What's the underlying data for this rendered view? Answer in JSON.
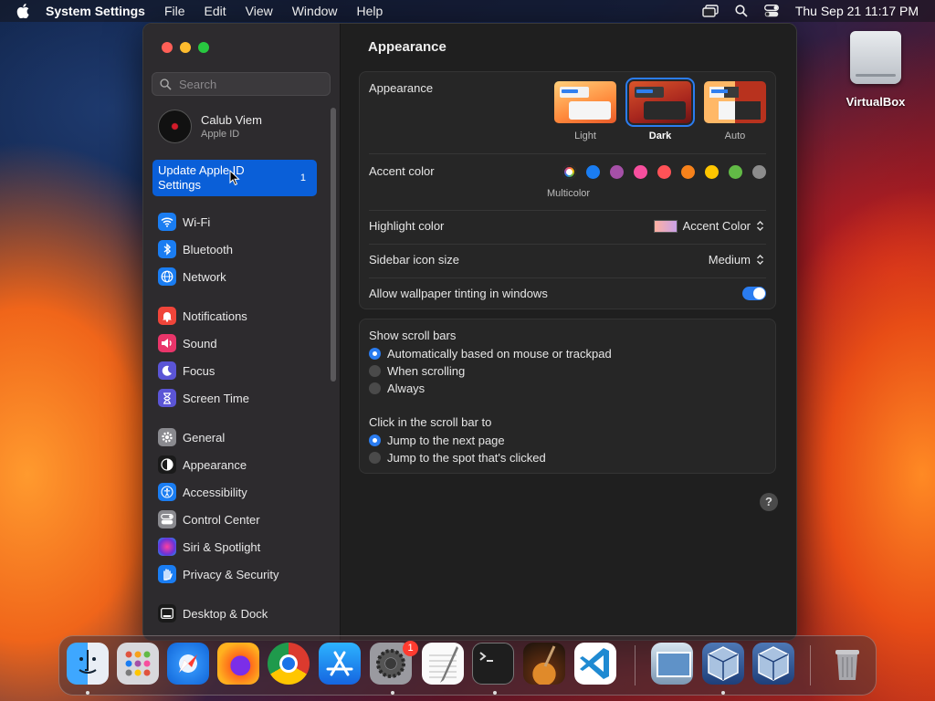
{
  "menubar": {
    "app": "System Settings",
    "items": [
      "File",
      "Edit",
      "View",
      "Window",
      "Help"
    ],
    "clock": "Thu Sep 21  11:17 PM"
  },
  "desktop": {
    "volume_label": "VirtualBox"
  },
  "sidebar": {
    "search_placeholder": "Search",
    "profile": {
      "name": "Calub Viem",
      "subtitle": "Apple ID"
    },
    "update": {
      "label": "Update Apple ID Settings",
      "badge": "1"
    },
    "items": [
      {
        "label": "Wi-Fi",
        "icon": "wifi-icon",
        "color": "#1a7df2"
      },
      {
        "label": "Bluetooth",
        "icon": "bluetooth-icon",
        "color": "#1a7df2"
      },
      {
        "label": "Network",
        "icon": "globe-icon",
        "color": "#1a7df2"
      },
      {
        "label": "Notifications",
        "icon": "bell-icon",
        "color": "#f0453a"
      },
      {
        "label": "Sound",
        "icon": "speaker-icon",
        "color": "#e9356a"
      },
      {
        "label": "Focus",
        "icon": "moon-icon",
        "color": "#5b55d6"
      },
      {
        "label": "Screen Time",
        "icon": "hourglass-icon",
        "color": "#5b55d6"
      },
      {
        "label": "General",
        "icon": "gear-icon",
        "color": "#8a8a8f"
      },
      {
        "label": "Appearance",
        "icon": "appearance-icon",
        "color": "#1a1a1a"
      },
      {
        "label": "Accessibility",
        "icon": "accessibility-icon",
        "color": "#1a7df2"
      },
      {
        "label": "Control Center",
        "icon": "control-center-icon",
        "color": "#8a8a8f"
      },
      {
        "label": "Siri & Spotlight",
        "icon": "siri-icon",
        "color": "#9b3ed4"
      },
      {
        "label": "Privacy & Security",
        "icon": "hand-icon",
        "color": "#1a7df2"
      },
      {
        "label": "Desktop & Dock",
        "icon": "dock-icon",
        "color": "#1a1a1a"
      }
    ]
  },
  "content": {
    "title": "Appearance",
    "appearance": {
      "label": "Appearance",
      "options": [
        "Light",
        "Dark",
        "Auto"
      ],
      "selected": "Dark"
    },
    "accent": {
      "label": "Accent color",
      "selected_caption": "Multicolor",
      "colors": [
        "multicolor",
        "#1a7df2",
        "#a550a7",
        "#f74f9e",
        "#ff5257",
        "#f7821b",
        "#ffc600",
        "#62ba46",
        "#8c8c8c"
      ]
    },
    "highlight": {
      "label": "Highlight color",
      "value": "Accent Color"
    },
    "icon_size": {
      "label": "Sidebar icon size",
      "value": "Medium"
    },
    "tinting": {
      "label": "Allow wallpaper tinting in windows",
      "on": true
    },
    "scroll_bars": {
      "label": "Show scroll bars",
      "options": [
        "Automatically based on mouse or trackpad",
        "When scrolling",
        "Always"
      ],
      "selected": 0
    },
    "scroll_click": {
      "label": "Click in the scroll bar to",
      "options": [
        "Jump to the next page",
        "Jump to the spot that's clicked"
      ],
      "selected": 0
    },
    "help": "?"
  },
  "dock": {
    "apps": [
      "Finder",
      "Launchpad",
      "Safari",
      "Firefox",
      "Chrome",
      "App Store",
      "System Settings",
      "TextEdit",
      "Terminal",
      "GarageBand",
      "Visual Studio Code",
      "Preview",
      "VirtualBox",
      "VirtualBox VM",
      "Trash"
    ],
    "settings_badge": "1"
  }
}
